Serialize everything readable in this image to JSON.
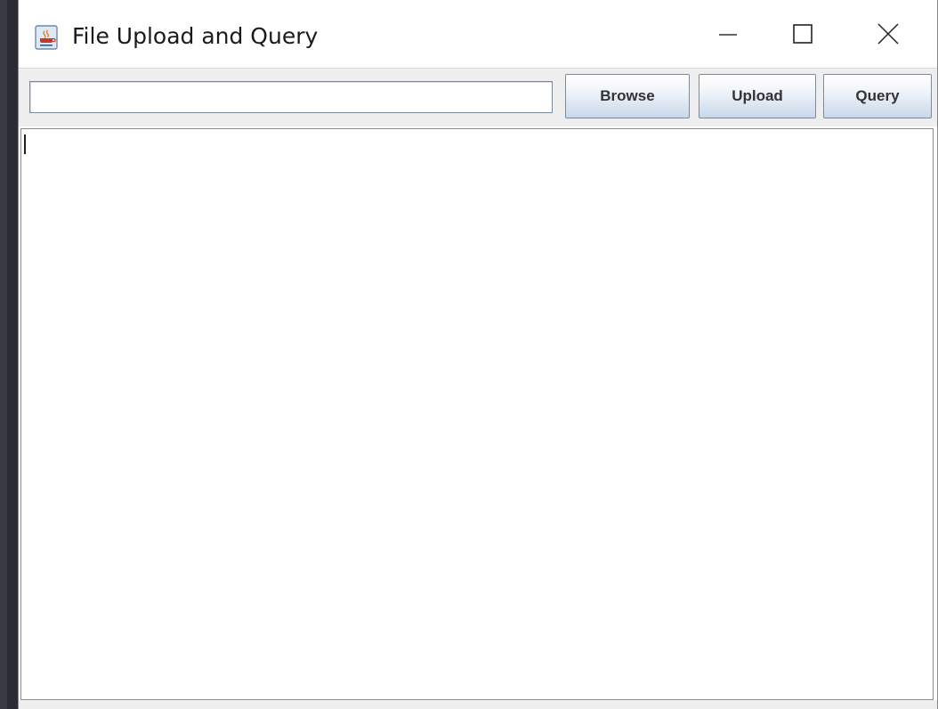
{
  "window": {
    "title": "File Upload and Query",
    "icon": "java-coffee-cup-icon"
  },
  "titlebar_controls": {
    "minimize_icon": "minimize-icon",
    "maximize_icon": "maximize-icon",
    "close_icon": "close-icon"
  },
  "toolbar": {
    "file_path_value": "",
    "browse_label": "Browse",
    "upload_label": "Upload",
    "query_label": "Query"
  },
  "output": {
    "text": ""
  },
  "colors": {
    "button_gradient_top": "#ffffff",
    "button_gradient_bottom": "#c9d8e8",
    "toolbar_bg": "#eeeeee",
    "desktop_bg": "#2b2b33"
  }
}
